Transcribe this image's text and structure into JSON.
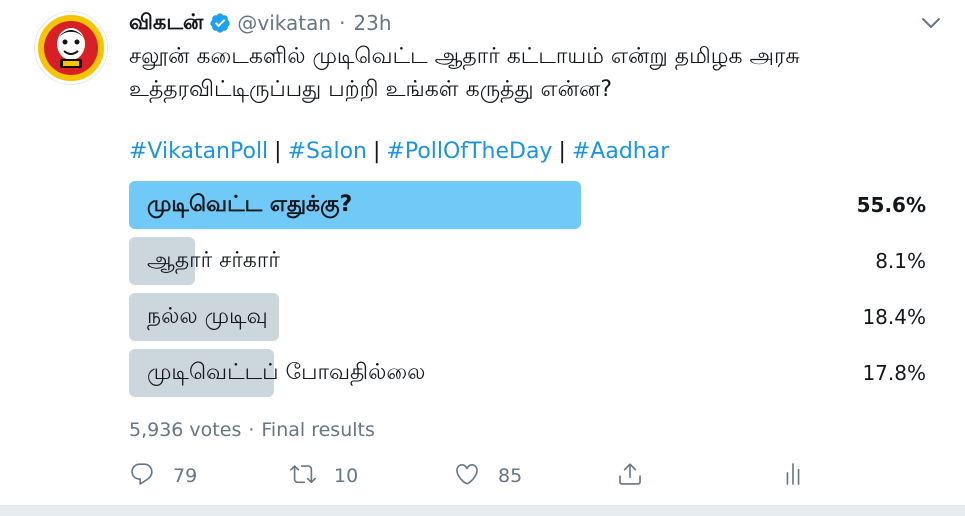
{
  "tweet": {
    "display_name": "விகடன்",
    "handle": "@vikatan",
    "separator": "·",
    "time": "23h",
    "text": "சலூன் கடைகளில் முடிவெட்ட ஆதார் கட்டாயம் என்று தமிழக அரசு உத்தரவிட்டிருப்பது பற்றி உங்கள் கருத்து என்ன?",
    "hashtags": [
      "#VikatanPoll",
      "#Salon",
      "#PollOfTheDay",
      "#Aadhar"
    ],
    "hashtag_separator": "|",
    "icons": {
      "avatar": "vikatan-logo",
      "verified": "verified-badge-icon",
      "menu": "chevron-down-icon"
    }
  },
  "poll": {
    "options": [
      {
        "label": "முடிவெட்ட எதுக்கு?",
        "percent_text": "55.6%",
        "percent": 55.6,
        "winner": true
      },
      {
        "label": "ஆதார் சர்கார்",
        "percent_text": "8.1%",
        "percent": 8.1,
        "winner": false
      },
      {
        "label": "நல்ல முடிவு",
        "percent_text": "18.4%",
        "percent": 18.4,
        "winner": false
      },
      {
        "label": "முடிவெட்டப் போவதில்லை",
        "percent_text": "17.8%",
        "percent": 17.8,
        "winner": false
      }
    ],
    "votes": "5,936 votes",
    "separator": "·",
    "status": "Final results"
  },
  "actions": {
    "reply_count": "79",
    "retweet_count": "10",
    "like_count": "85",
    "icons": [
      "reply-icon",
      "retweet-icon",
      "like-icon",
      "share-icon",
      "analytics-icon"
    ]
  },
  "colors": {
    "winner_bar": "#71c9f8",
    "other_bar": "#ccd6dd",
    "link": "#1b95e0",
    "verified": "#1da1f2",
    "secondary_text": "#657786"
  }
}
